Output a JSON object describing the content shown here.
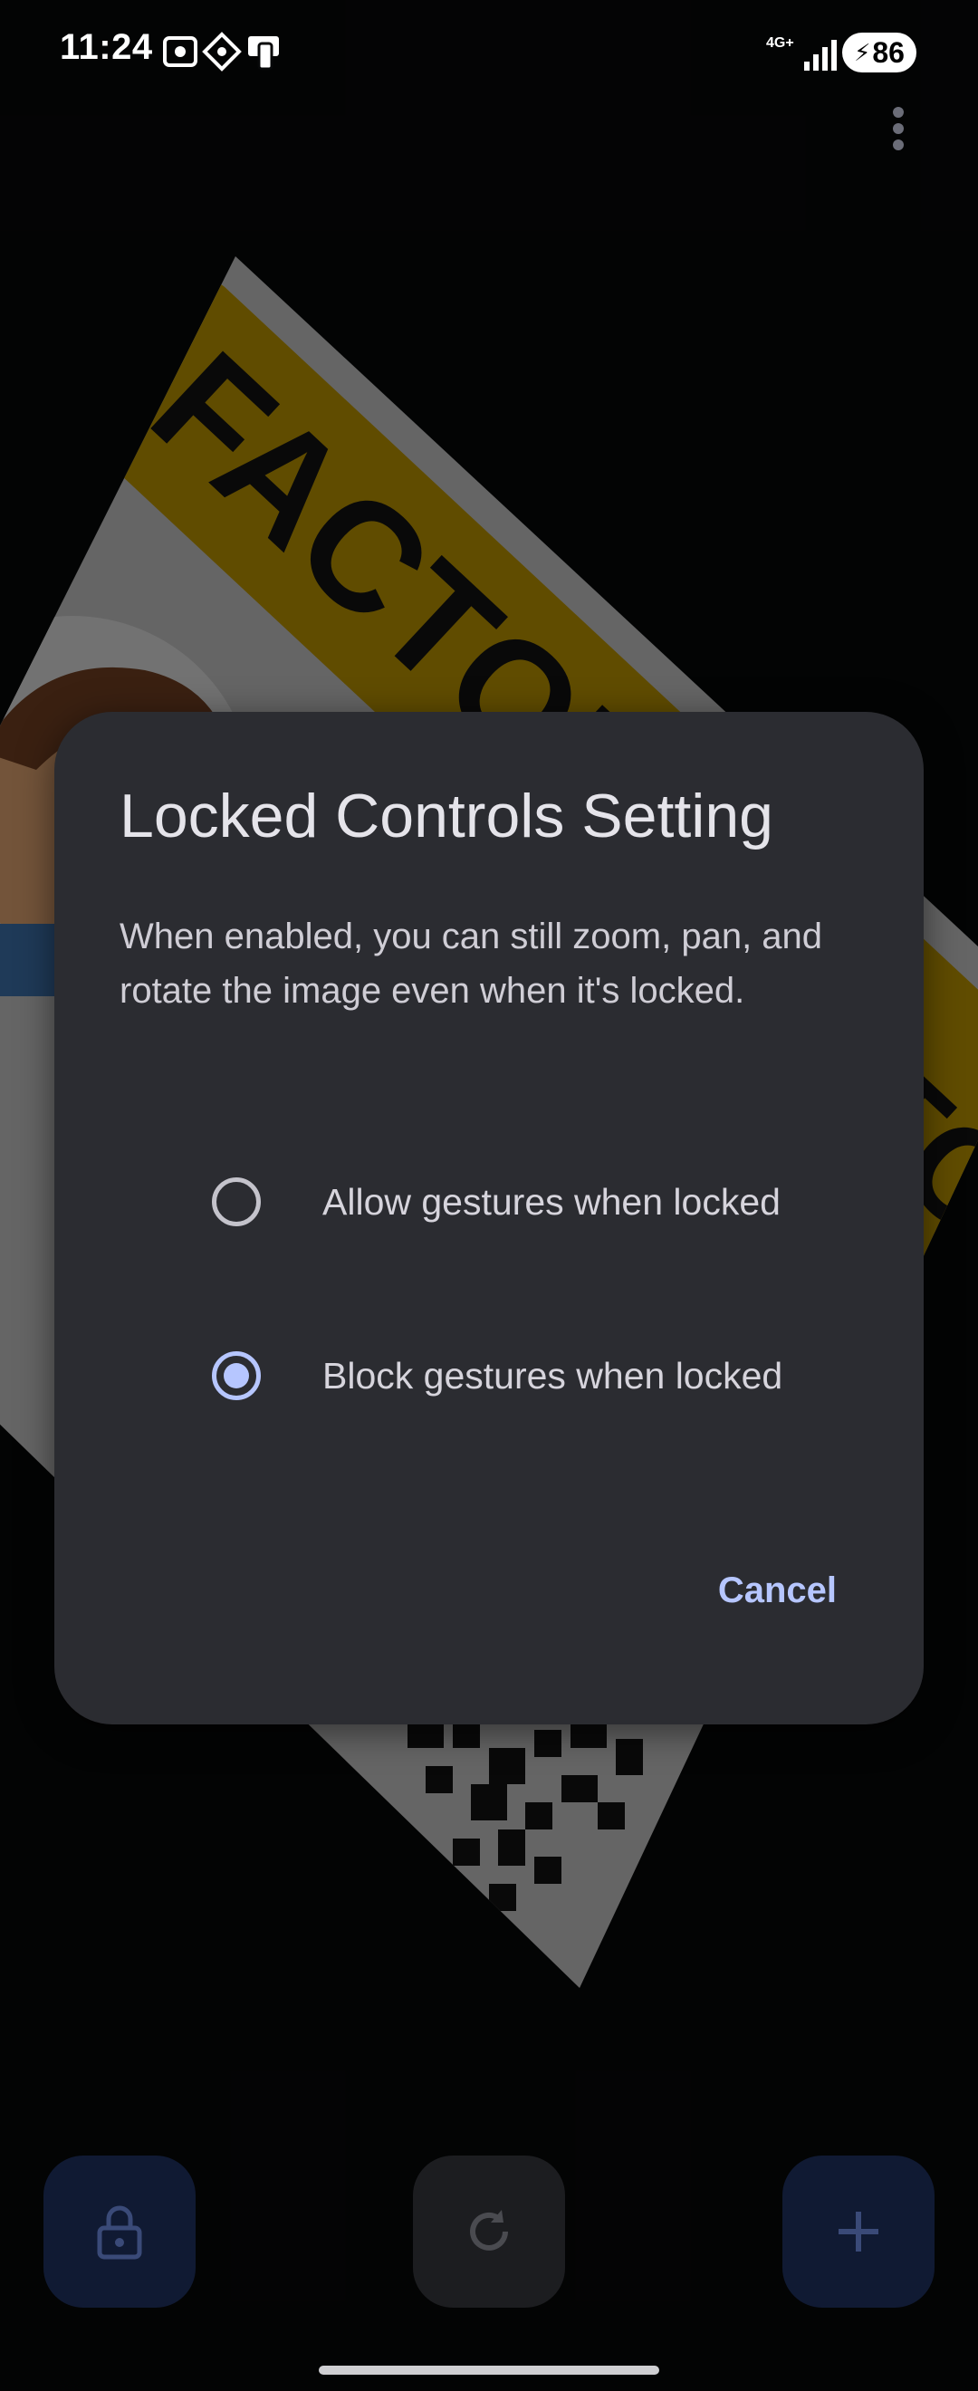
{
  "status_bar": {
    "time": "11:24",
    "network": "4G+",
    "battery": "86"
  },
  "background": {
    "card_banner_text": "FACTOR",
    "card_banner_text_right": "TO"
  },
  "dialog": {
    "title": "Locked Controls Setting",
    "description": "When enabled, you can still zoom, pan, and rotate the image even when it's locked.",
    "options": [
      {
        "label": "Allow gestures when locked",
        "selected": false
      },
      {
        "label": "Block gestures when locked",
        "selected": true
      }
    ],
    "cancel_label": "Cancel"
  },
  "bottom_bar": {
    "lock_icon": "lock-icon",
    "rotate_icon": "rotate-icon",
    "add_icon": "plus-icon"
  },
  "colors": {
    "accent": "#b6c6ff",
    "dialog_background": "#2b2c31",
    "fab_primary": "#101a33",
    "fab_secondary": "#1c1d20"
  }
}
